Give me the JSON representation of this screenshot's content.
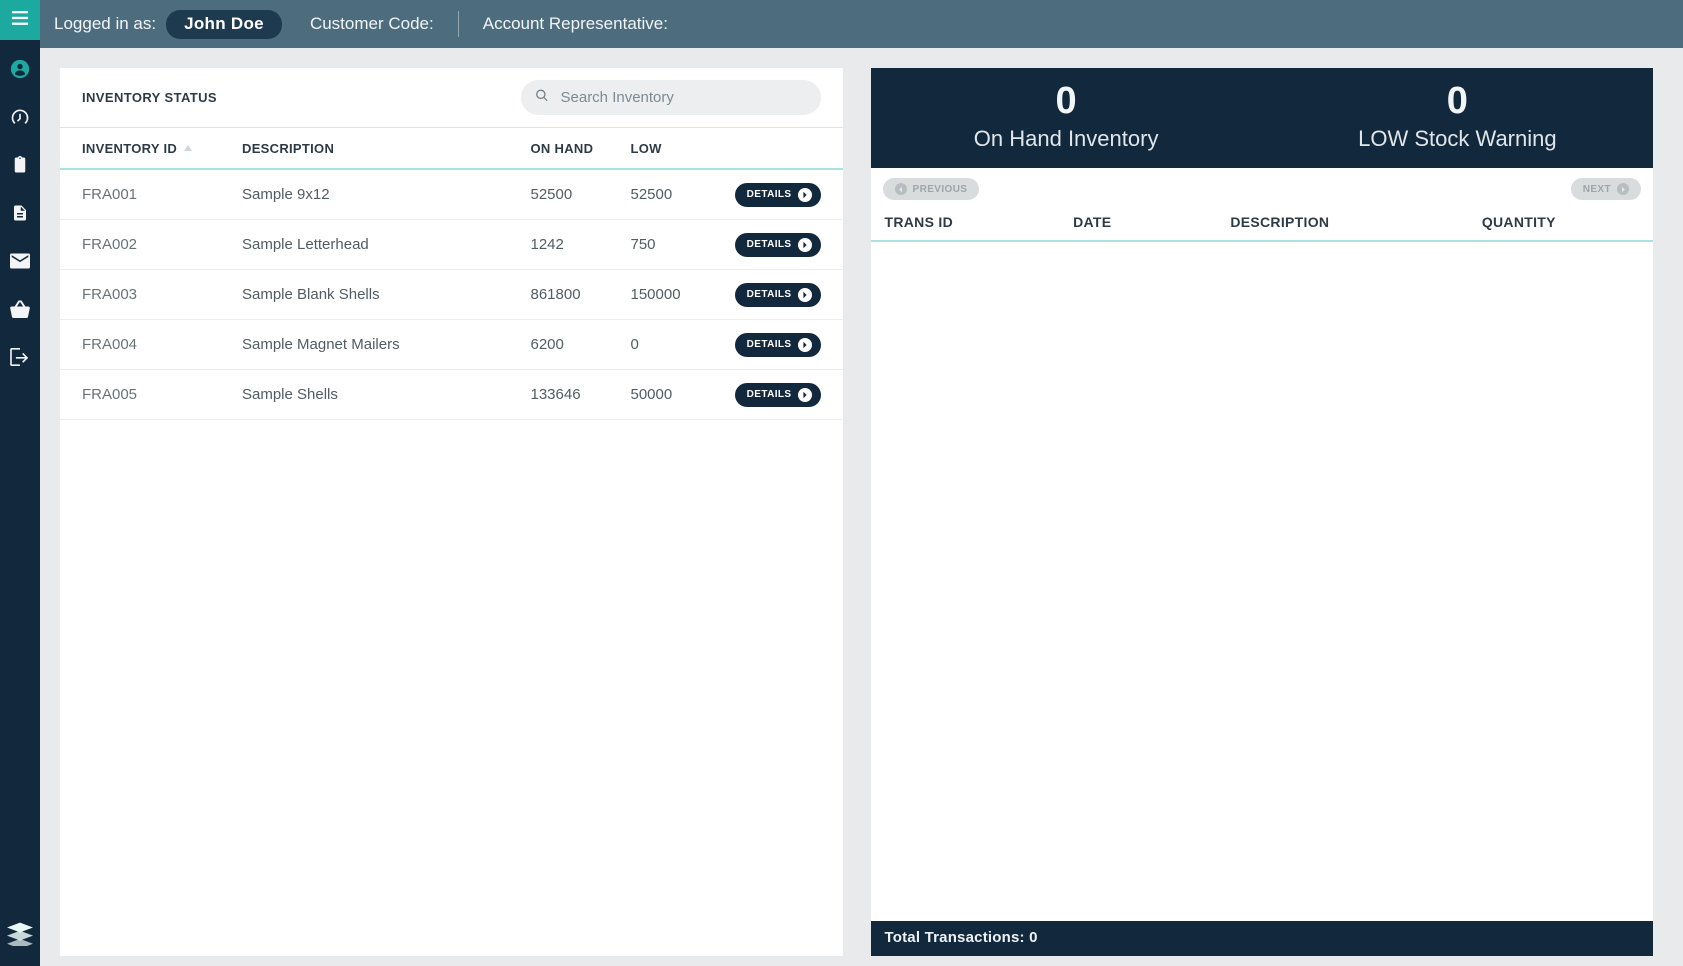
{
  "topbar": {
    "logged_label": "Logged in as:",
    "user_name": "John Doe",
    "customer_code_label": "Customer Code:",
    "account_rep_label": "Account Representative:"
  },
  "sidebar": {
    "items": [
      {
        "name": "hamburger"
      },
      {
        "name": "user"
      },
      {
        "name": "dashboard"
      },
      {
        "name": "clipboard"
      },
      {
        "name": "document"
      },
      {
        "name": "mail"
      },
      {
        "name": "basket"
      },
      {
        "name": "logout"
      }
    ]
  },
  "inventory": {
    "title": "INVENTORY STATUS",
    "search_placeholder": "Search Inventory",
    "columns": {
      "id": "INVENTORY ID",
      "desc": "DESCRIPTION",
      "onhand": "ON HAND",
      "low": "LOW"
    },
    "details_label": "DETAILS",
    "rows": [
      {
        "id": "FRA001",
        "desc": "Sample 9x12",
        "onhand": "52500",
        "low": "52500"
      },
      {
        "id": "FRA002",
        "desc": "Sample Letterhead",
        "onhand": "1242",
        "low": "750"
      },
      {
        "id": "FRA003",
        "desc": "Sample Blank Shells",
        "onhand": "861800",
        "low": "150000"
      },
      {
        "id": "FRA004",
        "desc": "Sample Magnet Mailers",
        "onhand": "6200",
        "low": "0"
      },
      {
        "id": "FRA005",
        "desc": "Sample Shells",
        "onhand": "133646",
        "low": "50000"
      }
    ]
  },
  "stats": {
    "onhand_value": "0",
    "onhand_label": "On Hand Inventory",
    "low_value": "0",
    "low_label": "LOW Stock Warning"
  },
  "pager": {
    "prev_label": "PREVIOUS",
    "next_label": "NEXT"
  },
  "transactions": {
    "columns": {
      "trans_id": "TRANS ID",
      "date": "DATE",
      "description": "DESCRIPTION",
      "quantity": "QUANTITY"
    },
    "footer_prefix": "Total Transactions: ",
    "total": "0"
  }
}
